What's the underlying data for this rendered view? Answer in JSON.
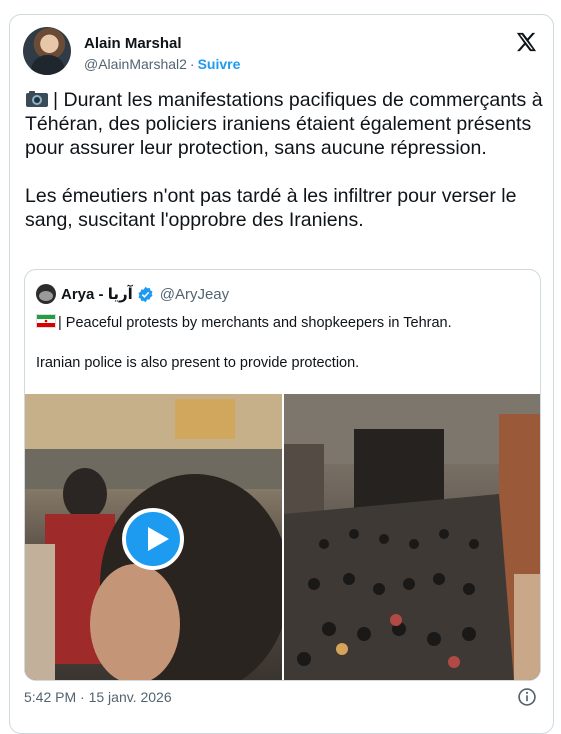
{
  "author": {
    "name": "Alain Marshal",
    "handle": "@AlainMarshal2",
    "separator": "·",
    "follow_label": "Suivre"
  },
  "tweet": {
    "paragraph1": "| Durant les manifestations pacifiques de commerçants à Téhéran, des policiers iraniens étaient également présents pour assurer leur protection, sans aucune répression.",
    "paragraph2": "Les émeutiers n'ont pas tardé à les infiltrer pour verser le sang, suscitant l'opprobre des Iraniens."
  },
  "quoted": {
    "name": "Arya - آریا",
    "handle": "@AryJeay",
    "line1": "| Peaceful protests by merchants and shopkeepers in Tehran.",
    "line2": "Iranian police is also present to provide protection."
  },
  "footer": {
    "timestamp": "5:42 PM · 15 janv. 2026"
  },
  "icons": [
    "camera-icon",
    "x-logo-icon",
    "verified-badge-icon",
    "iran-flag-icon",
    "play-icon",
    "info-icon"
  ],
  "colors": {
    "accent": "#1d9bf0",
    "text": "#0f1419",
    "secondary": "#536471",
    "border": "#cfd9de"
  }
}
